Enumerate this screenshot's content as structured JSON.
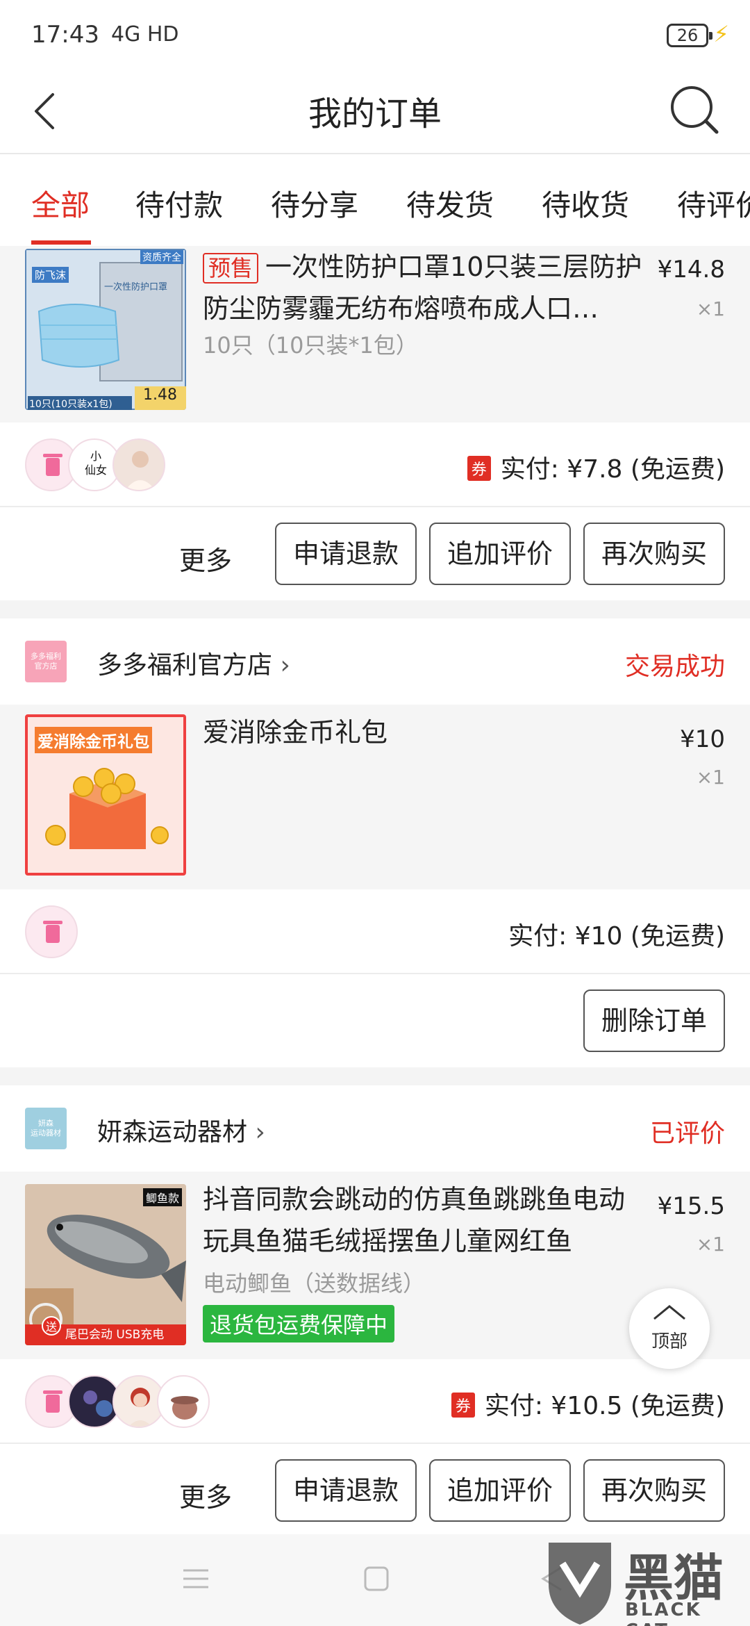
{
  "status_bar": {
    "time": "17:43",
    "network": "4G  HD",
    "battery": "26"
  },
  "header": {
    "title": "我的订单"
  },
  "tabs": [
    "全部",
    "待付款",
    "待分享",
    "待发货",
    "待收货",
    "待评价"
  ],
  "orders": [
    {
      "product": {
        "presale_tag": "预售",
        "name": "一次性防护口罩10只装三层防护防尘防雾霾无纺布熔喷布成人口…",
        "spec": "10只（10只装*1包）",
        "price": "¥14.8",
        "qty": "×1",
        "thumb_texts": {
          "brand": "防飞沫",
          "corner": "资质齐全",
          "pack": "一次性防护口罩",
          "bottom": "10只(10只装x1包)",
          "price": "1.48"
        }
      },
      "paid": {
        "coupon": "券",
        "text": "实付: ¥7.8 (免运费)"
      },
      "actions": {
        "more": "更多",
        "buttons": [
          "申请退款",
          "追加评价",
          "再次购买"
        ]
      }
    },
    {
      "shop": {
        "logo_text": "多多福利\n官方店",
        "name": "多多福利官方店",
        "status": "交易成功",
        "logo_color": "#f7a4b8"
      },
      "product": {
        "name": "爱消除金币礼包",
        "price": "¥10",
        "qty": "×1",
        "thumb_texts": {
          "banner": "爱消除金币礼包"
        }
      },
      "paid": {
        "text": "实付: ¥10 (免运费)"
      },
      "actions": {
        "buttons": [
          "删除订单"
        ]
      }
    },
    {
      "shop": {
        "logo_text": "妍森\n运动器材",
        "name": "妍森运动器材",
        "status": "已评价",
        "logo_color": "#9fcfe0"
      },
      "product": {
        "name": "抖音同款会跳动的仿真鱼跳跳鱼电动玩具鱼猫毛绒摇摆鱼儿童网红鱼",
        "spec": "电动鲫鱼（送数据线）",
        "guarantee": "退货包运费保障中",
        "price": "¥15.5",
        "qty": "×1",
        "thumb_texts": {
          "corner": "鲫鱼款",
          "bottom": "尾巴会动 USB充电",
          "gift": "送"
        }
      },
      "paid": {
        "coupon": "券",
        "text": "实付: ¥10.5 (免运费)"
      },
      "actions": {
        "more": "更多",
        "buttons": [
          "申请退款",
          "追加评价",
          "再次购买"
        ]
      }
    }
  ],
  "float_top": {
    "label": "顶部"
  },
  "watermark": {
    "cn": "黑猫",
    "en": "BLACK CAT"
  },
  "colors": {
    "accent": "#e02e24",
    "green": "#2bb63f"
  }
}
